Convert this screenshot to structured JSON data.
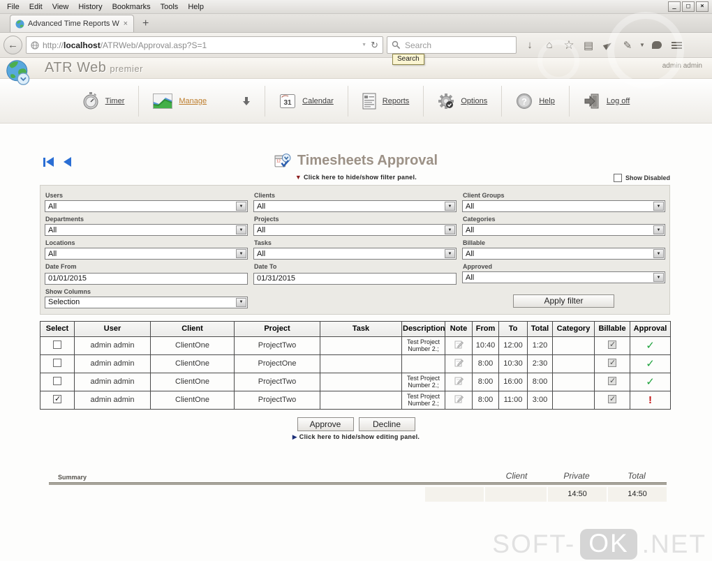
{
  "window": {
    "minimize": "_",
    "maximize": "□",
    "close": "×"
  },
  "browser": {
    "menu": [
      "File",
      "Edit",
      "View",
      "History",
      "Bookmarks",
      "Tools",
      "Help"
    ],
    "tab": {
      "title": "Advanced Time Reports Web ...",
      "close_glyph": "×",
      "new_tab_glyph": "+"
    },
    "url": {
      "protocol": "http://",
      "host": "localhost",
      "path": "/ATRWeb/Approval.asp?S=1"
    },
    "search": {
      "placeholder": "Search",
      "tooltip": "Search"
    }
  },
  "icons": {
    "back": "←",
    "url_dropdown": "▼",
    "reload": "↻",
    "download": "↓",
    "home": "⌂",
    "bookmark_star": "☆",
    "clipboard": "▤",
    "send": "css-plane",
    "page_actions": "✎",
    "toolbar_dropdown": "▼",
    "chat": "css-bubble",
    "menu": "css-bars",
    "tri_down": "▼",
    "tri_right": "▶",
    "dd_arrow": "▼"
  },
  "app_header": {
    "name": "ATR Web",
    "edition": "premier",
    "user": "admin admin"
  },
  "nav": {
    "items": [
      {
        "label": "Timer"
      },
      {
        "label": "Manage",
        "active": true
      },
      {
        "label": "Calendar"
      },
      {
        "label": "Reports"
      },
      {
        "label": "Options"
      },
      {
        "label": "Help"
      },
      {
        "label": "Log off"
      }
    ]
  },
  "page": {
    "title": "Timesheets Approval",
    "filter_toggle": "Click here to hide/show filter panel.",
    "editing_toggle": "Click here to hide/show editing panel.",
    "show_disabled_label": "Show Disabled",
    "show_disabled_checked": false
  },
  "filters": {
    "users": {
      "label": "Users",
      "value": "All"
    },
    "clients": {
      "label": "Clients",
      "value": "All"
    },
    "client_groups": {
      "label": "Client Groups",
      "value": "All"
    },
    "departments": {
      "label": "Departments",
      "value": "All"
    },
    "projects": {
      "label": "Projects",
      "value": "All"
    },
    "categories": {
      "label": "Categories",
      "value": "All"
    },
    "locations": {
      "label": "Locations",
      "value": "All"
    },
    "tasks": {
      "label": "Tasks",
      "value": "All"
    },
    "billable": {
      "label": "Billable",
      "value": "All"
    },
    "date_from": {
      "label": "Date From",
      "value": "01/01/2015"
    },
    "date_to": {
      "label": "Date To",
      "value": "01/31/2015"
    },
    "approved": {
      "label": "Approved",
      "value": "All"
    },
    "show_columns": {
      "label": "Show Columns",
      "value": "Selection"
    },
    "apply_label": "Apply filter"
  },
  "table": {
    "columns": [
      "Select",
      "User",
      "Client",
      "Project",
      "Task",
      "Description",
      "Note",
      "From",
      "To",
      "Total",
      "Category",
      "Billable",
      "Approval"
    ],
    "rows": [
      {
        "selected": false,
        "user": "admin admin",
        "client": "ClientOne",
        "project": "ProjectTwo",
        "task": "",
        "description": "Test Project Number 2.;",
        "from": "10:40",
        "to": "12:00",
        "total": "1:20",
        "category": "",
        "billable": true,
        "approval_glyph": "✓",
        "approval_class": "approval-ok"
      },
      {
        "selected": false,
        "user": "admin admin",
        "client": "ClientOne",
        "project": "ProjectOne",
        "task": "",
        "description": "",
        "from": "8:00",
        "to": "10:30",
        "total": "2:30",
        "category": "",
        "billable": true,
        "approval_glyph": "✓",
        "approval_class": "approval-ok"
      },
      {
        "selected": false,
        "user": "admin admin",
        "client": "ClientOne",
        "project": "ProjectTwo",
        "task": "",
        "description": "Test Project Number 2.;",
        "from": "8:00",
        "to": "16:00",
        "total": "8:00",
        "category": "",
        "billable": true,
        "approval_glyph": "✓",
        "approval_class": "approval-ok"
      },
      {
        "selected": true,
        "user": "admin admin",
        "client": "ClientOne",
        "project": "ProjectTwo",
        "task": "",
        "description": "Test Project Number 2.;",
        "from": "8:00",
        "to": "11:00",
        "total": "3:00",
        "category": "",
        "billable": true,
        "approval_glyph": "!",
        "approval_class": "approval-warn"
      }
    ]
  },
  "actions": {
    "approve": "Approve",
    "decline": "Decline"
  },
  "summary": {
    "label": "Summary",
    "col_client": "Client",
    "col_private": "Private",
    "col_total": "Total",
    "client_value": "",
    "private_value": "14:50",
    "total_value": "14:50"
  },
  "watermark": {
    "prefix": "SOFT-",
    "badge": "OK",
    "suffix": ".NET"
  },
  "colors": {
    "active_link": "#bd7d2c",
    "approved": "#1ea23c",
    "rejected": "#c41414",
    "title": "#9c9186",
    "arrow_blue": "#2a6ed4"
  }
}
